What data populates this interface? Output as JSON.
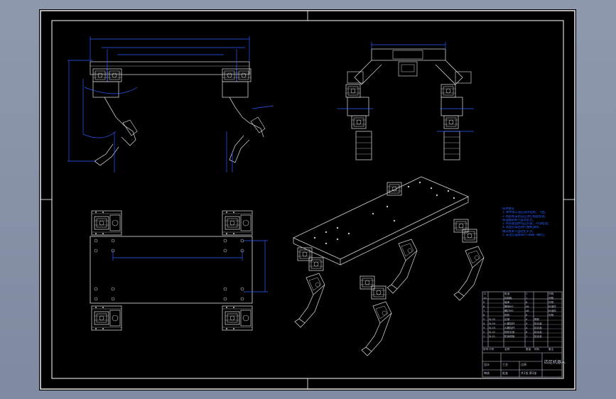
{
  "drawing": {
    "tech_notes": {
      "heading": "技术要求",
      "lines": [
        "1.零件加工后应去除毛刺、飞边。",
        "2.各舵机安装前应进行角度校准，",
        "  保证腿部关节运动灵活。",
        "3.所有紧固件均应拧紧，不得松动。",
        "4.装配完成后进行整机调试，",
        "  确认各关节运动无干涉。",
        "5.未注公差按GB/T1804-m执行。"
      ]
    },
    "title_block": {
      "drawing_title": "四足机器人",
      "company": "",
      "bom_header": [
        "序号",
        "代号",
        "名称",
        "数量",
        "材料",
        "备注"
      ],
      "bom_rows": [
        [
          "1",
          "SJ-01",
          "机身底板",
          "1",
          "铝合金",
          ""
        ],
        [
          "2",
          "SJ-02",
          "舵机支架",
          "8",
          "铝合金",
          ""
        ],
        [
          "3",
          "SJ-03",
          "大腿连杆",
          "4",
          "铝合金",
          ""
        ],
        [
          "4",
          "SJ-04",
          "小腿连杆",
          "4",
          "铝合金",
          ""
        ],
        [
          "5",
          "SJ-05",
          "足端",
          "4",
          "橡胶",
          ""
        ],
        [
          "6",
          "",
          "舵机",
          "8",
          "",
          "外购"
        ],
        [
          "7",
          "",
          "螺钉M3",
          "48",
          "",
          "标准件"
        ],
        [
          "8",
          "",
          "螺母M3",
          "48",
          "",
          "标准件"
        ],
        [
          "9",
          "",
          "轴承",
          "8",
          "",
          "外购"
        ],
        [
          "10",
          "",
          "控制板",
          "1",
          "",
          "外购"
        ],
        [
          "11",
          "",
          "电池",
          "1",
          "",
          "外购"
        ]
      ],
      "sign_labels": [
        "设计",
        "审核",
        "工艺",
        "批准"
      ],
      "scale_label": "比例",
      "sheet_label": "共1张 第1张"
    },
    "colors": {
      "background": "#000000",
      "geometry": "#c8c8c8",
      "dimension": "#2c5bff",
      "frame": "#ffffff"
    }
  }
}
